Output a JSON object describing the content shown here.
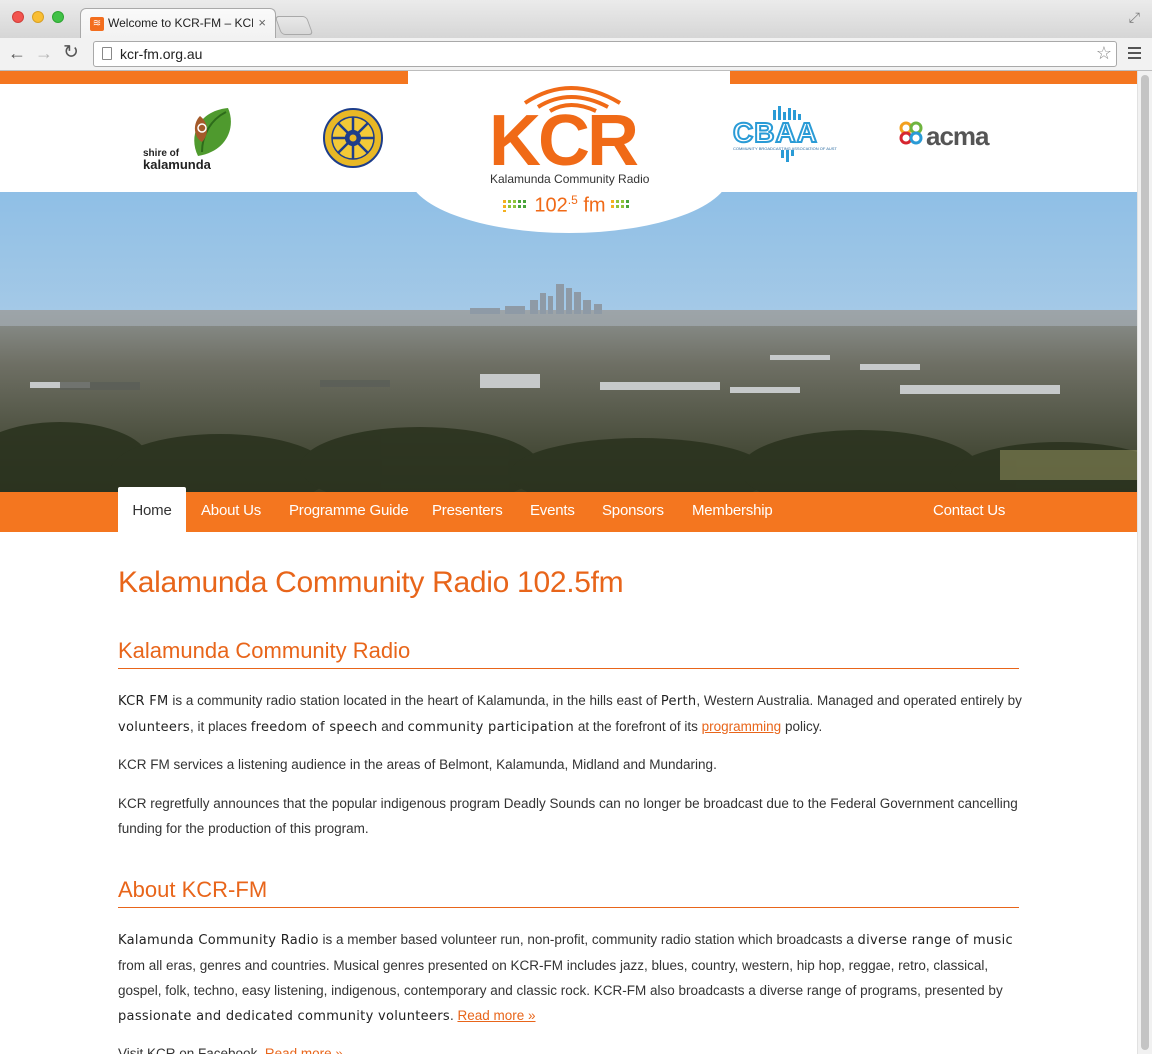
{
  "browser": {
    "tab_title": "Welcome to KCR-FM – KCR",
    "tab_close": "×",
    "url": "kcr-fm.org.au",
    "back": "←",
    "forward": "→",
    "reload": "↻",
    "star": "☆",
    "fullscreen": "⤢"
  },
  "header": {
    "shire_line1": "shire of",
    "shire_line2": "kalamunda",
    "kcr_logo": "KCR",
    "kcr_subtitle": "Kalamunda Community Radio",
    "kcr_freq_main": "102",
    "kcr_freq_sup": ".5",
    "kcr_freq_unit": " fm",
    "cbaa_text": "CBAA",
    "cbaa_sub": "COMMUNITY BROADCASTING ASSOCIATION OF AUSTRALIA",
    "acma_text": "acma",
    "rotary_text": "ROTARY INTERNATIONAL"
  },
  "nav": {
    "items": [
      "Home",
      "About Us",
      "Programme Guide",
      "Presenters",
      "Events",
      "Sponsors",
      "Membership",
      "Contact Us"
    ],
    "active": "Home"
  },
  "content": {
    "title": "Kalamunda Community Radio 102.5fm",
    "section1_heading": "Kalamunda Community Radio",
    "p1": {
      "s1": "KCR FM",
      "s2": " is a community radio station located in the heart of Kalamunda, in the hills east of ",
      "s3": "Perth",
      "s4": ", Western Australia. Managed and operated entirely by ",
      "s5": "volunteers",
      "s6": ", it places ",
      "s7": "freedom of speech",
      "s8": " and ",
      "s9": "community participation",
      "s10": " at the forefront of its ",
      "link": "programming",
      "s11": " policy."
    },
    "p2": "KCR FM services a listening audience in the areas of Belmont, Kalamunda, Midland and Mundaring.",
    "p3": "KCR regretfully announces that the popular indigenous program Deadly Sounds can no longer be broadcast due to the Federal Government cancelling funding for the production of this program.",
    "section2_heading": "About KCR-FM",
    "p4": {
      "s1": "Kalamunda Community Radio",
      "s2": " is a member based volunteer run, non-profit, community radio station which broadcasts a ",
      "s3": "diverse range of music",
      "s4": " from all eras, genres and countries. Musical genres presented on KCR-FM includes jazz, blues, country, western, hip hop, reggae, retro, classical, gospel, folk, techno, easy listening, indigenous, contemporary and classic rock. KCR-FM also broadcasts a diverse range of programs, presented by ",
      "s5": "passionate and dedicated community volunteers",
      "s6": ". ",
      "link": "Read more »"
    },
    "p5_text": "Visit KCR on Facebook. ",
    "p5_link": "Read more »"
  },
  "colors": {
    "brand_orange": "#f4761f",
    "heading_orange": "#e8651a"
  }
}
